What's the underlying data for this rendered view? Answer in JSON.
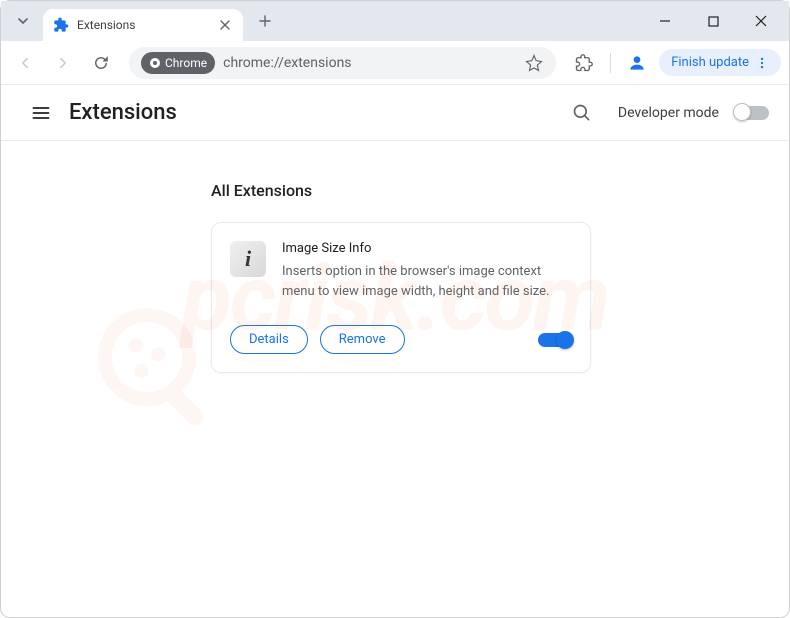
{
  "titlebar": {
    "tab_title": "Extensions"
  },
  "toolbar": {
    "chrome_chip": "Chrome",
    "url": "chrome://extensions",
    "finish_label": "Finish update"
  },
  "header": {
    "title": "Extensions",
    "dev_mode_label": "Developer mode",
    "dev_mode_on": false
  },
  "content": {
    "section_label": "All Extensions",
    "extensions": [
      {
        "name": "Image Size Info",
        "description": "Inserts option in the browser's image context menu to view image width, height and file size.",
        "details_label": "Details",
        "remove_label": "Remove",
        "enabled": true,
        "icon_glyph": "i"
      }
    ]
  },
  "watermark": "pcrisk.com"
}
